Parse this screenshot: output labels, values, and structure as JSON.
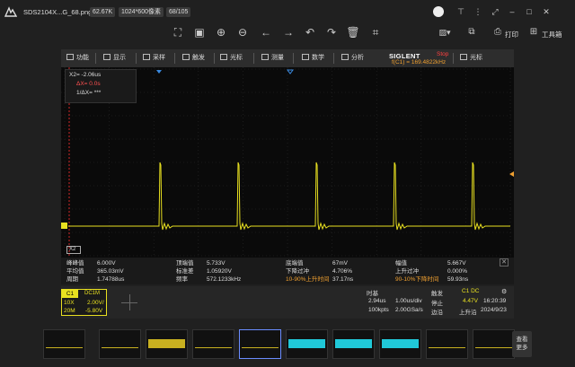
{
  "titlebar": {
    "filename": "SDS2104X...G_68.png",
    "filesize": "62.67K",
    "resolution": "1024*600像素",
    "index": "68/105"
  },
  "toolbar": {
    "print_label": "打印",
    "toolbox_label": "工具箱"
  },
  "menu": {
    "items": [
      "功能",
      "显示",
      "采样",
      "触发",
      "光标",
      "测量",
      "数学",
      "分析",
      "光标"
    ],
    "brand": "SIGLENT",
    "state": "Stop",
    "freq": "f(C1) = 169.4822kHz"
  },
  "cursor_box": {
    "x2": "X2= -2.06us",
    "dx": "ΔX= 0.0s",
    "inv_dx": "1/ΔX= ***",
    "x2_tag": "X2"
  },
  "measurements": {
    "row1": [
      [
        "峰峰值",
        "6.000V"
      ],
      [
        "顶端值",
        "5.733V"
      ],
      [
        "底端值",
        "67mV"
      ],
      [
        "幅值",
        "5.667V"
      ]
    ],
    "row2": [
      [
        "平均值",
        "365.03mV"
      ],
      [
        "标准差",
        "1.05920V"
      ],
      [
        "下降过冲",
        "4.706%"
      ],
      [
        "上升过冲",
        "0.000%"
      ]
    ],
    "row3": [
      [
        "周期",
        "1.74788us"
      ],
      [
        "频率",
        "572.1233kHz"
      ],
      [
        "10-90%上升时间",
        "37.17ns"
      ],
      [
        "90-10%下降时间",
        "59.93ns"
      ]
    ]
  },
  "channel": {
    "name": "C1",
    "coupling": "DC1M",
    "probe": "10X",
    "volts": "2.00V/",
    "bw": "20M",
    "offset": "-5.80V"
  },
  "timebase": {
    "label": "时基",
    "delay": "2.94us",
    "scale": "1.00us/div",
    "points": "100kpts",
    "rate": "2.00GSa/s"
  },
  "trigger": {
    "label": "触发",
    "source": "C1 DC",
    "mode": "停止",
    "level": "4.47V",
    "type": "边沿",
    "slope": "上升沿"
  },
  "clock": {
    "time": "16:20:39",
    "date": "2024/9/23"
  },
  "thumbs": {
    "more_label": "查看更多"
  },
  "colors": {
    "trace": "#e8e020",
    "accent": "#3a6ae0",
    "stop": "#ff4040"
  }
}
